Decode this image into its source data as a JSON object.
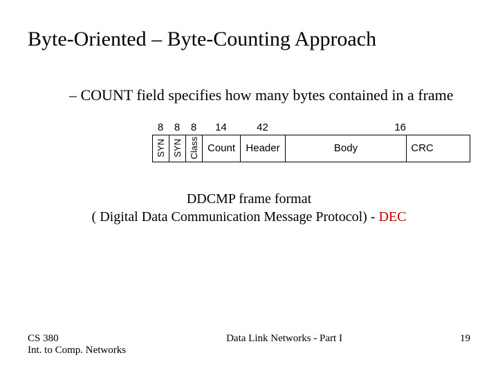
{
  "title": "Byte-Oriented – Byte-Counting Approach",
  "bullet": "COUNT field specifies how many bytes contained in a frame",
  "frame": {
    "bits": [
      "8",
      "8",
      "8",
      "14",
      "42",
      "16"
    ],
    "fields": [
      "SYN",
      "SYN",
      "Class",
      "Count",
      "Header",
      "Body",
      "CRC"
    ]
  },
  "caption": {
    "line1": "DDCMP frame format",
    "line2_prefix": "( Digital Data Communication Message Protocol) - ",
    "line2_dec": "DEC"
  },
  "footer": {
    "left_line1": " CS 380",
    "left_line2": "Int. to Comp. Networks",
    "center": "Data Link Networks - Part I",
    "page": "19"
  }
}
